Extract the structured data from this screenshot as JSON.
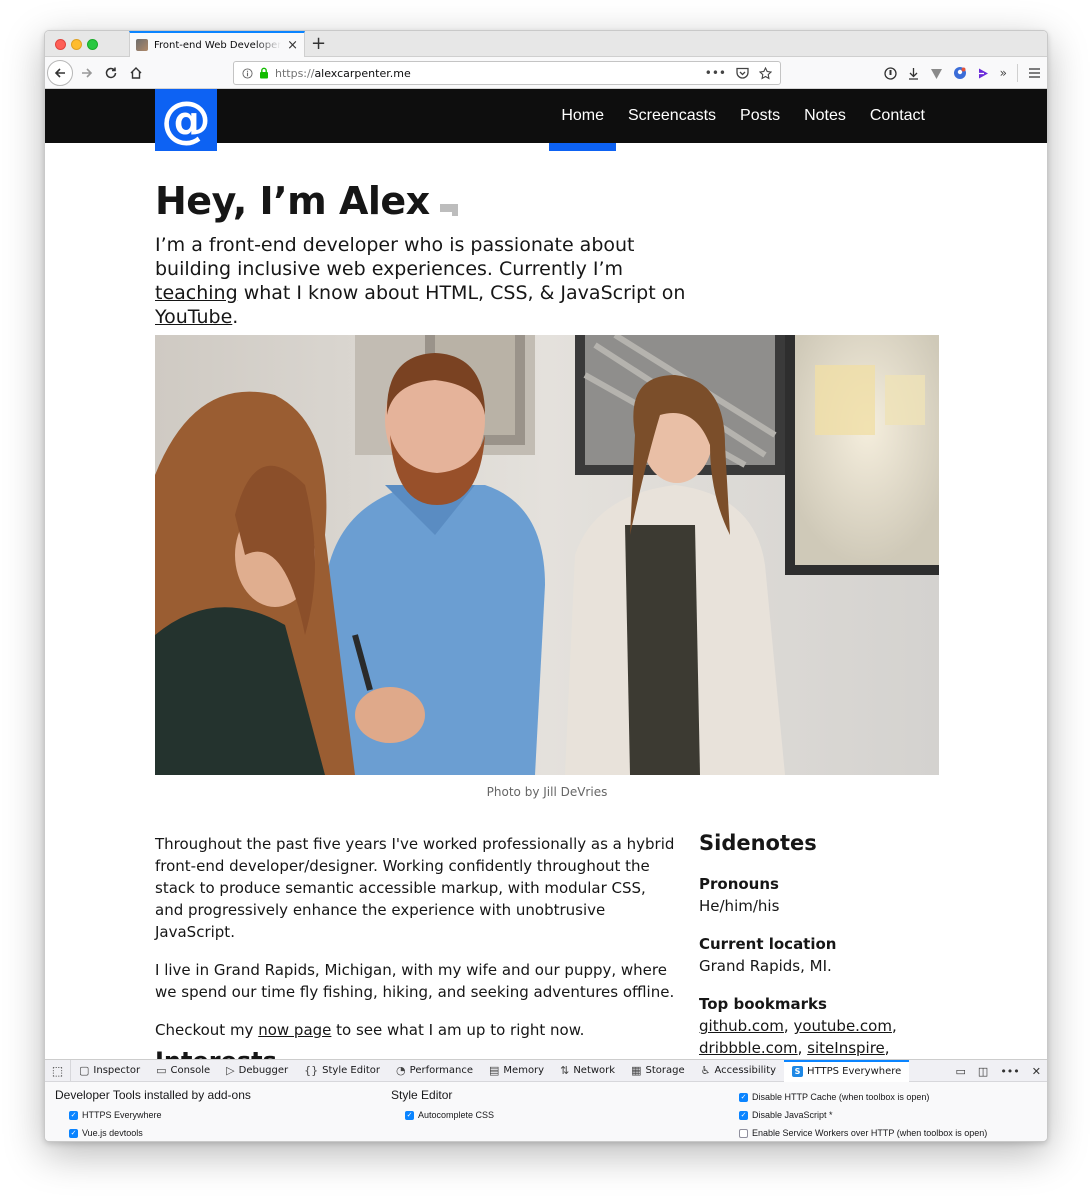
{
  "browser": {
    "tab_title": "Front-end Web Developer - Alex Carpenter",
    "url_scheme": "https://",
    "url_host": "alexcarpenter.me",
    "new_tab": "+",
    "close": "×"
  },
  "site": {
    "logo": "@",
    "nav": [
      {
        "label": "Home",
        "active": true
      },
      {
        "label": "Screencasts"
      },
      {
        "label": "Posts"
      },
      {
        "label": "Notes"
      },
      {
        "label": "Contact"
      }
    ],
    "hero_title": "Hey, I’m Alex",
    "intro": {
      "part1": "I’m a front-end developer who is passionate about building inclusive web experiences. Currently I’m ",
      "link1": "teaching",
      "part2": " what I know about HTML, CSS, & JavaScript on ",
      "link2": "YouTube",
      "part3": "."
    },
    "photo_caption": "Photo by Jill DeVries",
    "paragraphs": {
      "p1": "Throughout the past five years I've worked professionally as a hybrid front-end developer/designer. Working confidently throughout the stack to produce semantic accessible markup, with modular CSS, and progressively enhance the experience with unobtrusive JavaScript.",
      "p2": "I live in Grand Rapids, Michigan, with my wife and our puppy, where we spend our time fly fishing, hiking, and seeking adventures offline.",
      "p3_before": "Checkout my ",
      "p3_link": "now page",
      "p3_after": " to see what I am up to right now."
    },
    "interests_heading": "Interests",
    "sidenotes": {
      "title": "Sidenotes",
      "pronouns_label": "Pronouns",
      "pronouns_value": "He/him/his",
      "location_label": "Current location",
      "location_value": "Grand Rapids, MI.",
      "bookmarks_label": "Top bookmarks",
      "bookmarks": [
        "github.com",
        "youtube.com",
        "dribbble.com",
        "siteInspire"
      ]
    }
  },
  "devtools": {
    "tabs": [
      "Inspector",
      "Console",
      "Debugger",
      "Style Editor",
      "Performance",
      "Memory",
      "Network",
      "Storage",
      "Accessibility",
      "HTTPS Everywhere"
    ],
    "col1_heading": "Developer Tools installed by add-ons",
    "col1_items": [
      "HTTPS Everywhere",
      "Vue.js devtools"
    ],
    "col2_heading": "Style Editor",
    "col2_items": [
      "Autocomplete CSS"
    ],
    "col3_items": [
      "Disable HTTP Cache (when toolbox is open)",
      "Disable JavaScript *",
      "Enable Service Workers over HTTP (when toolbox is open)"
    ]
  },
  "colors": {
    "accent": "#0d62f3",
    "header_bg": "#0e0e0e",
    "text": "#161616"
  }
}
